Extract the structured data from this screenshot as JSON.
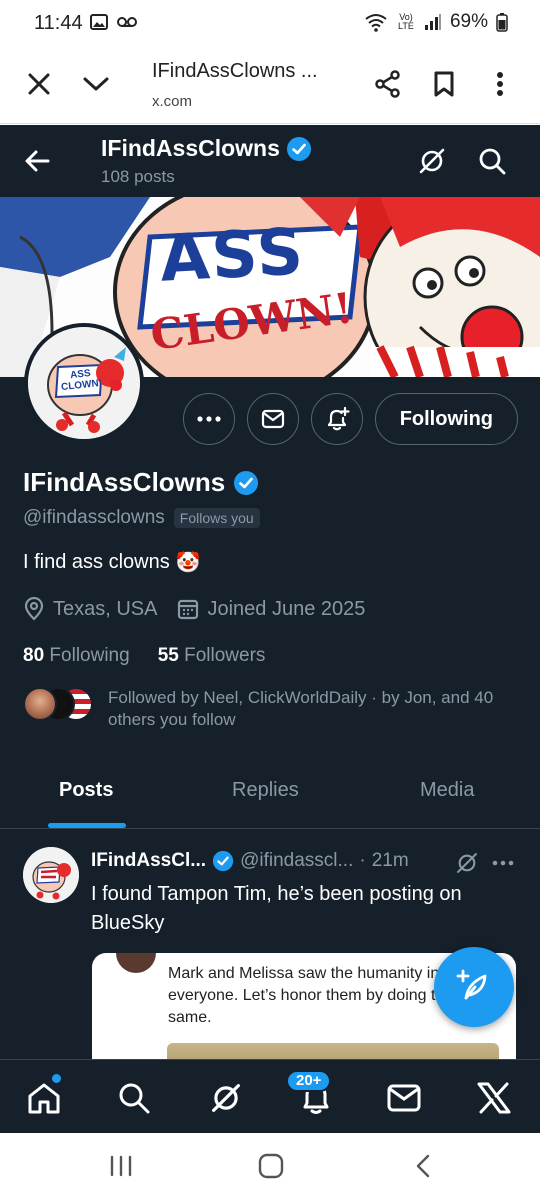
{
  "status_bar": {
    "time": "11:44",
    "battery": "69%",
    "network": "Vo) LTE"
  },
  "browser": {
    "title": "IFindAssClowns ...",
    "url": "x.com"
  },
  "profile": {
    "nav_name": "IFindAssClowns",
    "post_count": "108 posts",
    "display_name": "IFindAssClowns",
    "handle": "@ifindassclowns",
    "follows_you": "Follows you",
    "bio": "I find ass clowns",
    "bio_emoji": "🤡",
    "location": "Texas, USA",
    "joined": "Joined June 2025",
    "following_count": "80",
    "following_label": "Following",
    "followers_count": "55",
    "followers_label": "Followers",
    "followed_by": "Followed by Neel, ClickWorldDaily · by Jon, and 40 others you follow",
    "follow_button": "Following",
    "banner_text_1": "ASS",
    "banner_text_2": "CLOWN!",
    "avatar_text": "ASS CLOWN!"
  },
  "tabs": [
    {
      "label": "Posts",
      "active": true
    },
    {
      "label": "Replies",
      "active": false
    },
    {
      "label": "Media",
      "active": false
    }
  ],
  "tweet": {
    "name": "IFindAssCl...",
    "handle": "@ifindasscl...",
    "separator": "·",
    "time": "21m",
    "text": "I found Tampon Tim, he’s been posting on BlueSky",
    "quote_text": "Mark and Melissa saw the humanity in everyone. Let’s honor them by doing the same."
  },
  "bottom_nav": {
    "notification_badge": "20+"
  },
  "colors": {
    "app_bg": "#15202b",
    "accent": "#1d9bf0",
    "muted_text": "#8b98a5"
  }
}
